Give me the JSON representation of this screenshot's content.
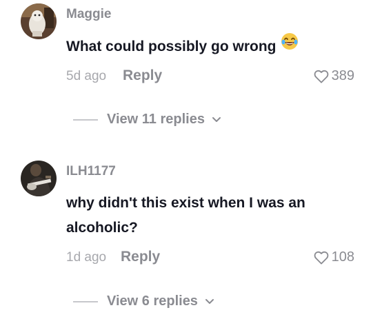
{
  "comments": [
    {
      "username": "Maggie",
      "text": "What could possibly go wrong",
      "emoji": "laughing-crying-emoji",
      "time": "5d ago",
      "reply_label": "Reply",
      "likes": "389",
      "view_replies": "View 11 replies"
    },
    {
      "username": "ILH1177",
      "text": "why didn't this exist when I was an alcoholic?",
      "time": "1d ago",
      "reply_label": "Reply",
      "likes": "108",
      "view_replies": "View 6 replies"
    }
  ],
  "icons": {
    "like": "heart-outline-icon",
    "expand": "chevron-down-icon"
  },
  "colors": {
    "text_primary": "#161823",
    "text_secondary": "#8a8b91",
    "text_muted": "#a7a8ad"
  }
}
